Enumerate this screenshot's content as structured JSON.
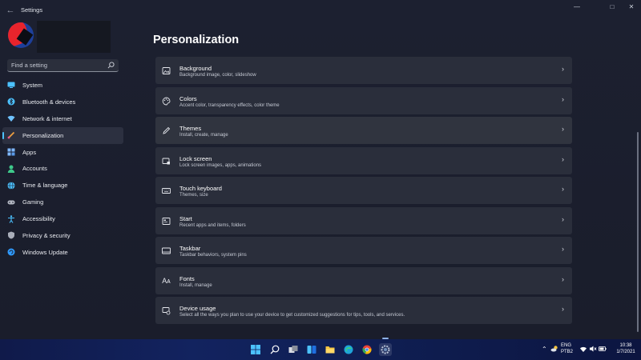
{
  "window": {
    "title": "Settings",
    "controls": [
      "minimize-icon",
      "maximize-icon",
      "close-icon"
    ]
  },
  "sidebar": {
    "search": {
      "placeholder": "Find a setting",
      "value": ""
    },
    "items": [
      {
        "label": "System",
        "icon": "monitor-icon",
        "color": "#4cc2ff"
      },
      {
        "label": "Bluetooth & devices",
        "icon": "bluetooth-icon",
        "color": "#4cc2ff"
      },
      {
        "label": "Network & internet",
        "icon": "wifi-icon",
        "color": "#6fc3ff"
      },
      {
        "label": "Personalization",
        "icon": "brush-icon",
        "color": "#f0a040",
        "active": true
      },
      {
        "label": "Apps",
        "icon": "apps-icon",
        "color": "#7fb8ff"
      },
      {
        "label": "Accounts",
        "icon": "person-icon",
        "color": "#3ec98b"
      },
      {
        "label": "Time & language",
        "icon": "globe-icon",
        "color": "#4cc2ff"
      },
      {
        "label": "Gaming",
        "icon": "gamepad-icon",
        "color": "#b5b9c4"
      },
      {
        "label": "Accessibility",
        "icon": "accessibility-icon",
        "color": "#4cc2ff"
      },
      {
        "label": "Privacy & security",
        "icon": "shield-icon",
        "color": "#a9aeb9"
      },
      {
        "label": "Windows Update",
        "icon": "update-icon",
        "color": "#2f9bff"
      }
    ]
  },
  "main": {
    "title": "Personalization",
    "cards": [
      {
        "title": "Background",
        "subtitle": "Background image, color, slideshow",
        "icon": "image-icon"
      },
      {
        "title": "Colors",
        "subtitle": "Accent color, transparency effects, color theme",
        "icon": "palette-icon"
      },
      {
        "title": "Themes",
        "subtitle": "Install, create, manage",
        "icon": "pen-icon"
      },
      {
        "title": "Lock screen",
        "subtitle": "Lock screen images, apps, animations",
        "icon": "lock-screen-icon"
      },
      {
        "title": "Touch keyboard",
        "subtitle": "Themes, size",
        "icon": "keyboard-icon"
      },
      {
        "title": "Start",
        "subtitle": "Recent apps and items, folders",
        "icon": "start-icon"
      },
      {
        "title": "Taskbar",
        "subtitle": "Taskbar behaviors, system pins",
        "icon": "taskbar-icon"
      },
      {
        "title": "Fonts",
        "subtitle": "Install, manage",
        "icon": "fonts-icon"
      },
      {
        "title": "Device usage",
        "subtitle": "Select all the ways you plan to use your device to get customized suggestions for tips, tools, and services.",
        "icon": "device-usage-icon"
      }
    ]
  },
  "taskbar": {
    "apps": [
      "windows-start-icon",
      "search-icon",
      "task-view-icon",
      "widgets-icon",
      "file-explorer-icon",
      "edge-icon",
      "chrome-icon",
      "settings-icon"
    ],
    "tray": {
      "lang_top": "ENG",
      "lang_bottom": "PTB2",
      "time": "10:38",
      "date": "1/7/2021"
    }
  }
}
